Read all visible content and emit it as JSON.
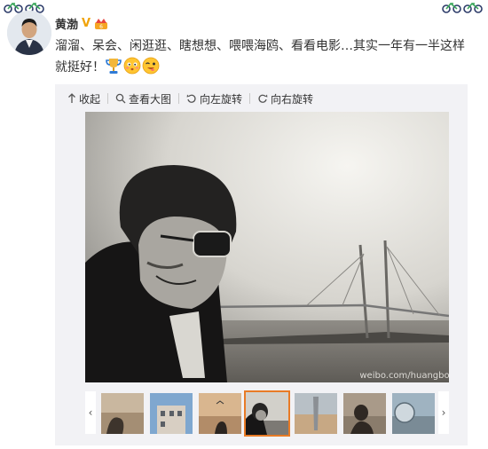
{
  "user": {
    "name": "黄渤",
    "verified_mark": "V",
    "rank_icon": "crown-badge-icon",
    "avatar": "user-avatar-photo"
  },
  "post": {
    "text": "溜溜、呆会、闲逛逛、瞎想想、喂喂海鸥、看看电影…其实一年有一半这样就挺好！",
    "emojis": [
      "trophy-icon",
      "blush-face-icon",
      "wink-face-icon"
    ]
  },
  "toolbar": {
    "collapse_label": "收起",
    "view_large_label": "查看大图",
    "rotate_left_label": "向左旋转",
    "rotate_right_label": "向右旋转"
  },
  "image": {
    "watermark": "weibo.com/huangbo",
    "description_icon": "selfie-bridge-photo"
  },
  "thumbnails": {
    "count": 8,
    "active_index": 3,
    "prev_symbol": "‹",
    "next_symbol": "›"
  },
  "colors": {
    "active_border": "#e87b26",
    "vip": "#f0a30a",
    "panel_bg": "#f2f2f5"
  }
}
